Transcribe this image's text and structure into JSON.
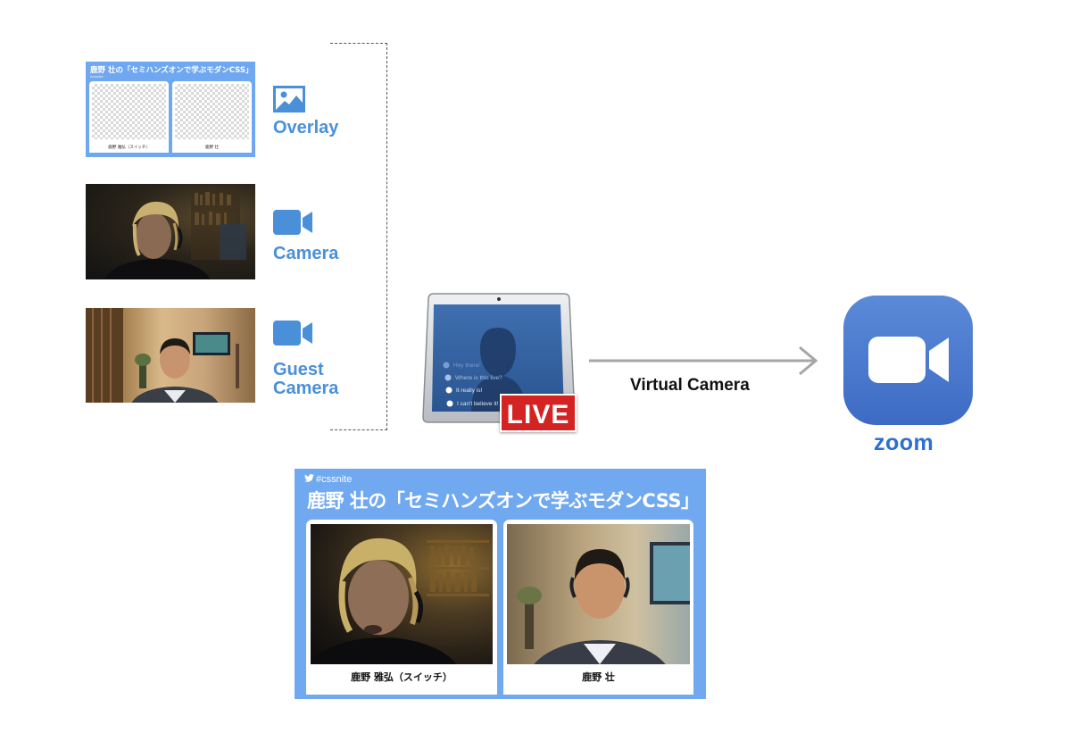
{
  "sources": {
    "overlay_thumb": {
      "title": "鹿野 壮の「セミハンズオンで学ぶモダンCSS」",
      "hashtag": "#cssnite",
      "names": [
        "鹿野 雅弘（スイッチ）",
        "鹿野 壮"
      ]
    },
    "labels": {
      "overlay": "Overlay",
      "camera": "Camera",
      "guest_line1": "Guest",
      "guest_line2": "Camera"
    },
    "icons": [
      "image-icon",
      "video-camera-icon",
      "video-camera-icon"
    ]
  },
  "ecamm": {
    "badge": "LIVE",
    "chat": [
      "Hey there!",
      "Where is this live?",
      "It really is!",
      "I can't believe it!"
    ]
  },
  "arrow": {
    "label": "Virtual Camera"
  },
  "zoom": {
    "wordmark": "zoom"
  },
  "output": {
    "hashtag": "#cssnite",
    "title": "鹿野 壮の「セミハンズオンで学ぶモダンCSS」",
    "names": [
      "鹿野 雅弘（スイッチ）",
      "鹿野 壮"
    ]
  },
  "colors": {
    "accent": "#4a90d9",
    "overlay_bg": "#70a9f0",
    "live_red": "#d42323",
    "zoom_blue": "#2d6fd0"
  }
}
